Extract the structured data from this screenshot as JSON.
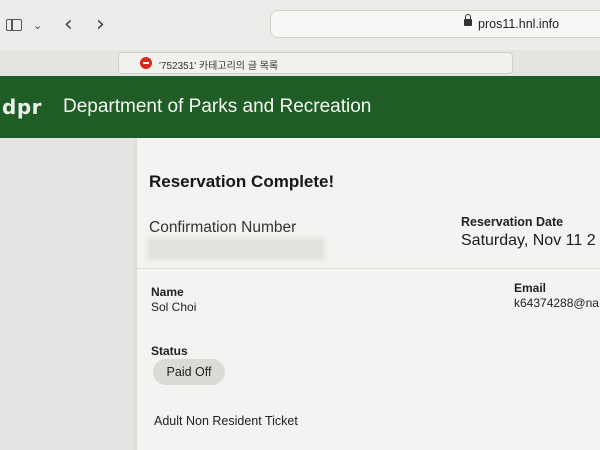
{
  "browser": {
    "url": "pros11.hnl.info",
    "tab_title": "'752351' 카테고리의 글 목록",
    "tab_favicon_color": "#d9291c",
    "icons": [
      "sidebar-icon",
      "chevron-down-icon",
      "back-arrow-icon",
      "forward-arrow-icon",
      "lock-icon"
    ]
  },
  "header": {
    "logo_text": "dpr",
    "title": "Department of Parks and Recreation",
    "background_color": "#1f5c26"
  },
  "reservation": {
    "heading": "Reservation Complete!",
    "confirmation_label": "Confirmation Number",
    "date_label": "Reservation Date",
    "date_value": "Saturday, Nov 11 2",
    "name_label": "Name",
    "name_value": "Sol Choi",
    "email_label": "Email",
    "email_value": "k64374288@na",
    "status_label": "Status",
    "status_value": "Paid Off",
    "ticket_type": "Adult Non Resident Ticket"
  }
}
